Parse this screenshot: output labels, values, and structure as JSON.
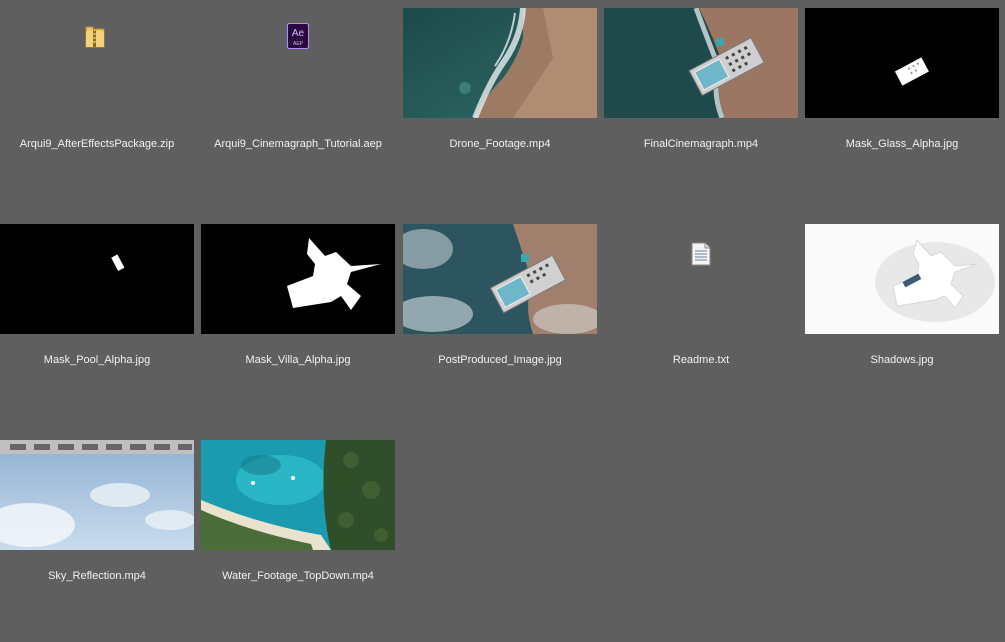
{
  "files": [
    {
      "name": "Arqui9_AfterEffectsPackage.zip",
      "icon": "zip-folder-icon"
    },
    {
      "name": "Arqui9_Cinemagraph_Tutorial.aep",
      "icon": "after-effects-icon",
      "icon_text": "Ae",
      "icon_subtext": "AEP"
    },
    {
      "name": "Drone_Footage.mp4"
    },
    {
      "name": "FinalCinemagraph.mp4"
    },
    {
      "name": "Mask_Glass_Alpha.jpg"
    },
    {
      "name": "Mask_Pool_Alpha.jpg"
    },
    {
      "name": "Mask_Villa_Alpha.jpg"
    },
    {
      "name": "PostProduced_Image.jpg"
    },
    {
      "name": "Readme.txt",
      "icon": "text-file-icon"
    },
    {
      "name": "Shadows.jpg"
    },
    {
      "name": "Sky_Reflection.mp4"
    },
    {
      "name": "Water_Footage_TopDown.mp4"
    }
  ],
  "colors": {
    "background": "#5f5f5f",
    "label_text": "#f2f2f2",
    "ae_purple": "#2a0a3e",
    "ae_accent": "#b58cff"
  }
}
